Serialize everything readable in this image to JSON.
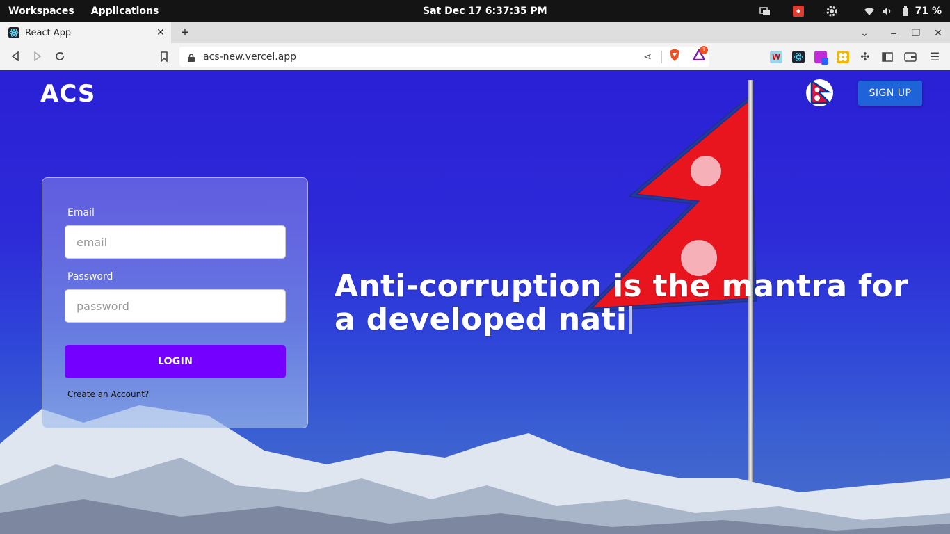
{
  "os_bar": {
    "workspaces": "Workspaces",
    "applications": "Applications",
    "clock": "Sat Dec 17   6:37:35 PM",
    "battery": "71 %"
  },
  "browser": {
    "tab_title": "React App",
    "url": "acs-new.vercel.app",
    "notification_badge": "1"
  },
  "page": {
    "logo": "ACS",
    "signup_label": "SIGN UP",
    "login": {
      "email_label": "Email",
      "email_placeholder": "email",
      "email_value": "",
      "password_label": "Password",
      "password_placeholder": "password",
      "password_value": "",
      "login_label": "LOGIN",
      "create_account": "Create an Account?"
    },
    "headline": "Anti-corruption is the mantra for a developed nati"
  },
  "colors": {
    "login_button": "#7400ff",
    "signup_button": "#1f63d8",
    "page_background": "#2a22d0"
  }
}
